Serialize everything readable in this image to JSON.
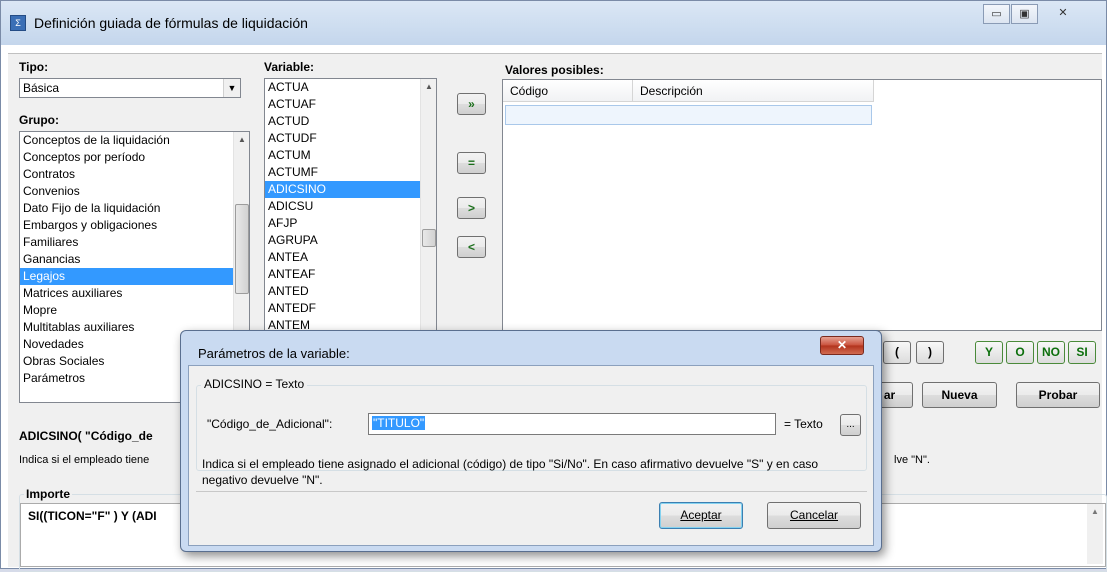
{
  "window": {
    "title": "Definición guiada de fórmulas de liquidación",
    "min_label": "▭",
    "max_label": "▣",
    "close_label": "✕"
  },
  "tipo": {
    "label": "Tipo:",
    "value": "Básica"
  },
  "grupo": {
    "label": "Grupo:",
    "items": [
      "Conceptos de la liquidación",
      "Conceptos por período",
      "Contratos",
      "Convenios",
      "Dato Fijo de la liquidación",
      "Embargos y obligaciones",
      "Familiares",
      "Ganancias",
      "Legajos",
      "Matrices auxiliares",
      "Mopre",
      "Multitablas auxiliares",
      "Novedades",
      "Obras Sociales",
      "Parámetros"
    ],
    "selected": "Legajos"
  },
  "variable": {
    "label": "Variable:",
    "items": [
      "ACTUA",
      "ACTUAF",
      "ACTUD",
      "ACTUDF",
      "ACTUM",
      "ACTUMF",
      "ADICSINO",
      "ADICSU",
      "AFJP",
      "AGRUPA",
      "ANTEA",
      "ANTEAF",
      "ANTED",
      "ANTEDF",
      "ANTEM"
    ],
    "selected": "ADICSINO"
  },
  "move_buttons": {
    "add_all": "»",
    "equals": "=",
    "add": ">",
    "remove": "<"
  },
  "valores": {
    "label": "Valores posibles:",
    "col_codigo": "Código",
    "col_descripcion": "Descripción"
  },
  "tools": {
    "paren_open": "(",
    "paren_close": ")",
    "y": "Y",
    "o": "O",
    "no": "NO",
    "si": "SI"
  },
  "actions": {
    "partial": "ar",
    "nueva": "Nueva",
    "probar": "Probar"
  },
  "info": {
    "signature": "ADICSINO( \"Código_de",
    "desc_left": "Indica si el empleado tiene",
    "desc_right": "lve \"N\"."
  },
  "importe": {
    "label": "Importe",
    "formula": "SI((TICON=\"F\" ) Y (ADI"
  },
  "dialog": {
    "title": "Parámetros de la variable:",
    "close_label": "✕",
    "group_title": "ADICSINO = Texto",
    "param_label": "\"Código_de_Adicional\":",
    "param_value": "\"TITULO\"",
    "type_label": "= Texto",
    "browse_label": "...",
    "description": "Indica si el empleado tiene asignado el adicional (código) de tipo \"Si/No\". En caso afirmativo devuelve \"S\" y en caso negativo devuelve \"N\".",
    "accept": "Aceptar",
    "cancel": "Cancelar"
  }
}
